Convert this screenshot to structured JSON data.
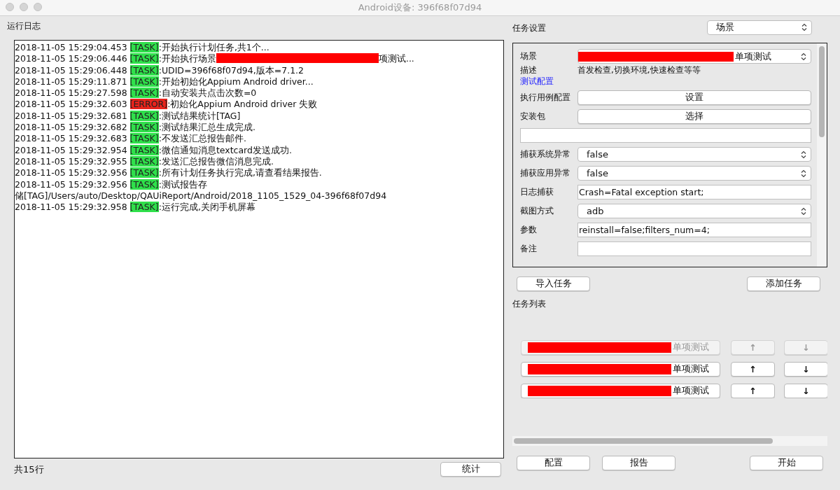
{
  "window": {
    "title": "Android设备: 396f68f07d94"
  },
  "log": {
    "title": "运行日志",
    "lines": [
      {
        "kind": "task",
        "time": "2018-11-05 15:29:04.453",
        "tag": "[TASK]",
        "message": ":开始执行计划任务,共1个..."
      },
      {
        "kind": "task",
        "time": "2018-11-05 15:29:06.446",
        "tag": "[TASK]",
        "message": ":开始执行场景",
        "redacted": true,
        "message_after": "项测试..."
      },
      {
        "kind": "task",
        "time": "2018-11-05 15:29:06.448",
        "tag": "[TASK]",
        "message": ":UDID=396f68f07d94,版本=7.1.2"
      },
      {
        "kind": "task",
        "time": "2018-11-05 15:29:11.871",
        "tag": "[TASK]",
        "message": ":开始初始化Appium Android driver..."
      },
      {
        "kind": "task",
        "time": "2018-11-05 15:29:27.598",
        "tag": "[TASK]",
        "message": ":自动安装共点击次数=0"
      },
      {
        "kind": "error",
        "time": "2018-11-05 15:29:32.603",
        "tag": "[ERROR]",
        "message": ":初始化Appium Android driver 失败"
      },
      {
        "kind": "task",
        "time": "2018-11-05 15:29:32.681",
        "tag": "[TASK]",
        "message": ":测试结果统计[TAG]"
      },
      {
        "kind": "task",
        "time": "2018-11-05 15:29:32.682",
        "tag": "[TASK]",
        "message": ":测试结果汇总生成完成."
      },
      {
        "kind": "task",
        "time": "2018-11-05 15:29:32.683",
        "tag": "[TASK]",
        "message": ":不发送汇总报告邮件."
      },
      {
        "kind": "task",
        "time": "2018-11-05 15:29:32.954",
        "tag": "[TASK]",
        "message": ":微信通知消息textcard发送成功."
      },
      {
        "kind": "task",
        "time": "2018-11-05 15:29:32.955",
        "tag": "[TASK]",
        "message": ":发送汇总报告微信消息完成."
      },
      {
        "kind": "task",
        "time": "2018-11-05 15:29:32.956",
        "tag": "[TASK]",
        "message": ":所有计划任务执行完成,请查看结果报告."
      },
      {
        "kind": "task",
        "time": "2018-11-05 15:29:32.956",
        "tag": "[TASK]",
        "message": ":测试报告存"
      },
      {
        "kind": "continuation",
        "message": "储[TAG]/Users/auto/Desktop/QAUiReport/Android/2018_1105_1529_04-396f68f07d94"
      },
      {
        "kind": "task",
        "time": "2018-11-05 15:29:32.958",
        "tag": "[TASK]",
        "message": ":运行完成,关闭手机屏幕"
      }
    ],
    "count": "共15行",
    "stats_button": "统计"
  },
  "task_settings": {
    "title": "任务设置",
    "mode_select": "场景",
    "fields": [
      {
        "kind": "select",
        "label": "场景",
        "value": "单项测试",
        "redacted": true
      },
      {
        "kind": "description",
        "label": "描述",
        "value": "首发检查,切换环境,快速检查等等"
      },
      {
        "kind": "link",
        "label": "测试配置"
      },
      {
        "kind": "button",
        "label": "执行用例配置",
        "value": "设置"
      },
      {
        "kind": "button",
        "label": "安装包",
        "value": "选择"
      },
      {
        "kind": "input"
      },
      {
        "kind": "select",
        "label": "捕获系统异常",
        "value": "false"
      },
      {
        "kind": "select",
        "label": "捕获应用异常",
        "value": "false"
      },
      {
        "kind": "input",
        "label": "日志捕获",
        "value": "Crash=Fatal exception start;"
      },
      {
        "kind": "select",
        "label": "截图方式",
        "value": "adb"
      },
      {
        "kind": "input",
        "label": "参数",
        "value": "reinstall=false;filters_num=4;"
      },
      {
        "kind": "input",
        "label": "备注"
      }
    ],
    "import_button": "导入任务",
    "add_button": "添加任务"
  },
  "task_list": {
    "title": "任务列表",
    "tasks": [
      {
        "label": "单项测试",
        "redacted": true,
        "disabled": true,
        "up": "↑",
        "down": "↓"
      },
      {
        "label": "单项测试",
        "redacted": true,
        "disabled": false,
        "up": "↑",
        "down": "↓"
      },
      {
        "label": "单项测试",
        "redacted": true,
        "disabled": false,
        "up": "↑",
        "down": "↓"
      }
    ]
  },
  "bottom_buttons": [
    "配置",
    "报告",
    "开始"
  ]
}
